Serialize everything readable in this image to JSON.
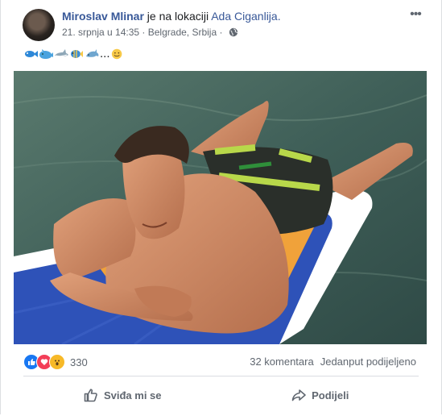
{
  "post": {
    "author": "Miroslav Mlinar",
    "action_text": " je na lokaciji ",
    "location": "Ada Ciganlija.",
    "time": "21. srpnja u 14:35",
    "meta_separator": " · ",
    "place": "Belgrade, Srbija",
    "meta_separator2": " · ",
    "text_suffix": "...",
    "emoji_icons": [
      "fish-icon",
      "whale-icon",
      "shark-icon",
      "tropical-fish-icon",
      "dolphin-icon"
    ],
    "final_emoji": "smile-emoji-icon"
  },
  "reactions": {
    "icons": [
      "like-reaction-icon",
      "love-reaction-icon",
      "wow-reaction-icon"
    ],
    "count": "330"
  },
  "stats": {
    "comments": "32 komentara",
    "shares": "Jedanput podijeljeno"
  },
  "actions": {
    "like_label": "Sviđa mi se",
    "share_label": "Podijeli"
  },
  "colors": {
    "link": "#385898",
    "meta": "#606770",
    "like_blue": "#1877f2",
    "love_red": "#f33e58",
    "wow_yellow": "#f7b928"
  }
}
